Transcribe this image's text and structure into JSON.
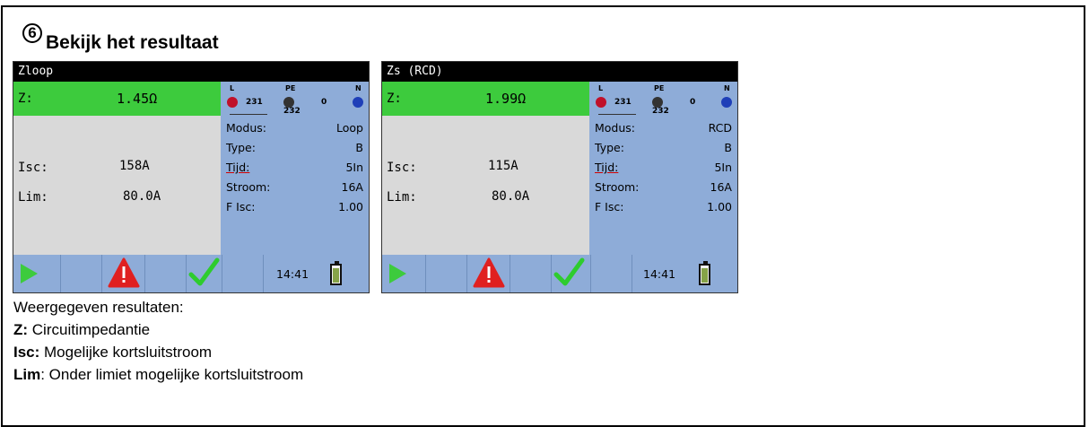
{
  "step_number": "6",
  "heading": "Bekijk het resultaat",
  "screens": [
    {
      "title": "Zloop",
      "z_label": "Z:",
      "z_value": "1.45Ω",
      "isc_label": "Isc:",
      "isc_value": "158A",
      "lim_label": "Lim:",
      "lim_value": "80.0A",
      "terminals": {
        "l_label": "L",
        "pe_label": "PE",
        "n_label": "N",
        "l_pe_value": "231",
        "pe_n_value": "0",
        "l_n_value": "232"
      },
      "params": [
        {
          "key": "Modus:",
          "value": "Loop"
        },
        {
          "key": "Type:",
          "value": "B"
        },
        {
          "key": "Tijd:",
          "value": "5In"
        },
        {
          "key": "Stroom:",
          "value": "16A"
        },
        {
          "key": "F Isc:",
          "value": "1.00"
        }
      ],
      "time": "14:41",
      "battery_level": 0.9
    },
    {
      "title": "Zs (RCD)",
      "z_label": "Z:",
      "z_value": "1.99Ω",
      "isc_label": "Isc:",
      "isc_value": "115A",
      "lim_label": "Lim:",
      "lim_value": "80.0A",
      "terminals": {
        "l_label": "L",
        "pe_label": "PE",
        "n_label": "N",
        "l_pe_value": "231",
        "pe_n_value": "0",
        "l_n_value": "232"
      },
      "params": [
        {
          "key": "Modus:",
          "value": "RCD"
        },
        {
          "key": "Type:",
          "value": "B"
        },
        {
          "key": "Tijd:",
          "value": "5In"
        },
        {
          "key": "Stroom:",
          "value": "16A"
        },
        {
          "key": "F Isc:",
          "value": "1.00"
        }
      ],
      "time": "14:41",
      "battery_level": 0.9
    }
  ],
  "description": {
    "intro": "Weergegeven resultaten:",
    "items": [
      {
        "term": "Z:",
        "text": " Circuitimpedantie"
      },
      {
        "term": "Isc:",
        "text": " Mogelijke kortsluitstroom"
      },
      {
        "term": "Lim",
        "text": ": Onder limiet mogelijke kortsluitstroom"
      }
    ]
  },
  "colors": {
    "result_highlight": "#3dcb3d",
    "panel_blue": "#8eacd8",
    "result_area": "#d9d9d9",
    "play_green": "#3dcb3d",
    "warning_red": "#e02020",
    "check_green": "#2ecc2e",
    "terminal_l": "#c0102a",
    "terminal_pe": "#333333",
    "terminal_n": "#1f3fb8"
  },
  "icons": [
    "play-icon",
    "warning-icon",
    "checkmark-icon",
    "battery-icon"
  ]
}
